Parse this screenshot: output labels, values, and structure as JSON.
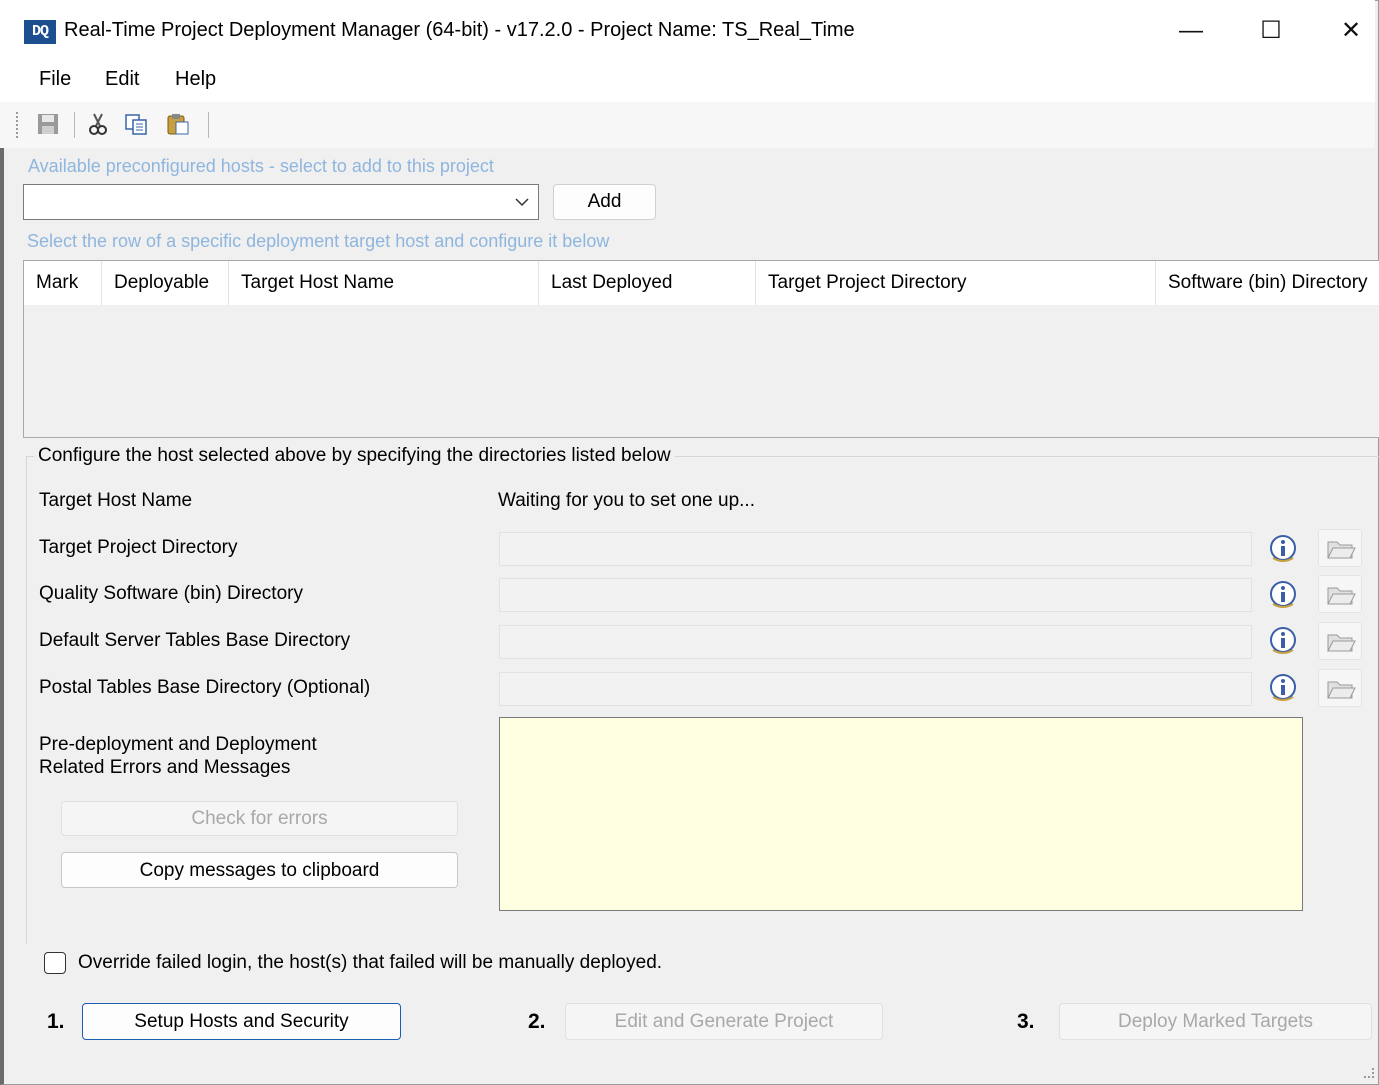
{
  "window": {
    "title": "Real-Time Project Deployment Manager (64-bit) - v17.2.0  -  Project Name: TS_Real_Time",
    "app_icon_text": "DQ",
    "minimize": "—",
    "maximize": "☐",
    "close": "✕"
  },
  "menu": {
    "file": "File",
    "edit": "Edit",
    "help": "Help"
  },
  "toolbar": {
    "icons": [
      "save-icon",
      "cut-icon",
      "copy-icon",
      "paste-icon"
    ]
  },
  "hosts": {
    "hint": "Available preconfigured hosts - select to add to this project",
    "selected": "",
    "add_label": "Add"
  },
  "grid": {
    "hint": "Select the row of a specific deployment target host and configure it below",
    "columns": [
      "Mark",
      "Deployable",
      "Target Host Name",
      "Last Deployed",
      "Target Project Directory",
      "Software (bin) Directory"
    ],
    "rows": []
  },
  "config": {
    "legend": "Configure the host selected above by specifying the directories listed below",
    "target_host_label": "Target Host Name",
    "target_host_value": "Waiting for you to set one up...",
    "target_project_dir_label": "Target Project Directory",
    "target_project_dir_value": "",
    "quality_software_dir_label": "Quality Software (bin) Directory",
    "quality_software_dir_value": "",
    "server_tables_dir_label": "Default Server Tables Base Directory",
    "server_tables_dir_value": "",
    "postal_tables_dir_label": "Postal Tables Base Directory (Optional)",
    "postal_tables_dir_value": "",
    "messages_label_line1": "Pre-deployment and Deployment",
    "messages_label_line2": "Related Errors and Messages",
    "messages_text": "",
    "check_errors_label": "Check for errors",
    "copy_messages_label": "Copy messages to clipboard"
  },
  "override": {
    "checked": false,
    "label": "Override failed login, the host(s) that failed will be manually deployed."
  },
  "steps": {
    "step1_num": "1.",
    "step1_label": "Setup Hosts and Security",
    "step2_num": "2.",
    "step2_label": "Edit and Generate Project",
    "step3_num": "3.",
    "step3_label": "Deploy Marked Targets"
  },
  "colors": {
    "hint": "#8fb6de",
    "messages_bg": "#ffffe1",
    "primary_border": "#1a5fb4"
  }
}
